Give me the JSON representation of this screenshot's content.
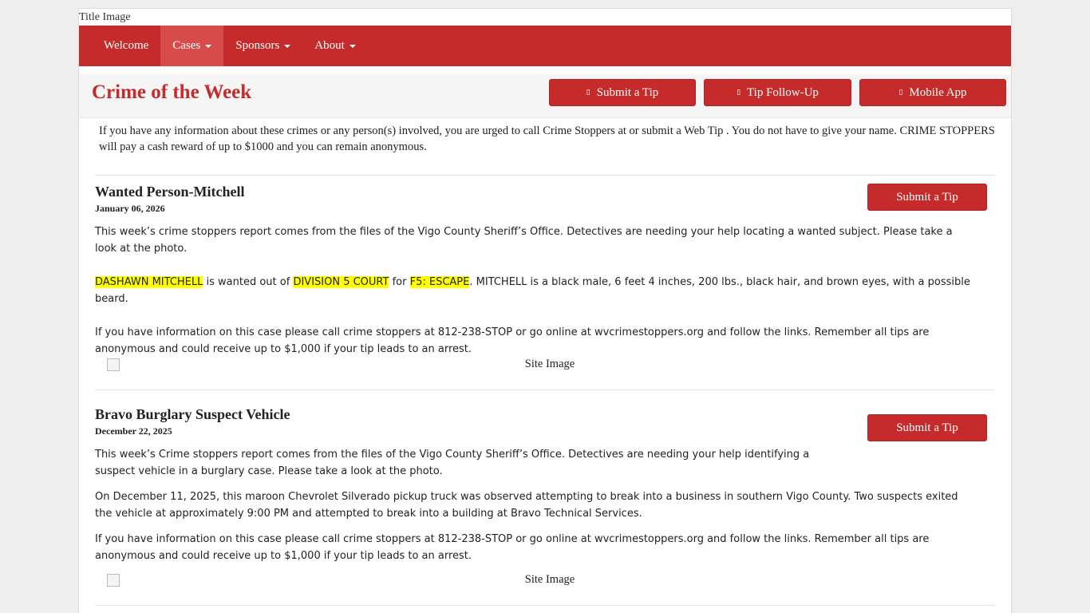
{
  "title_image_alt": "Title Image",
  "nav": {
    "items": [
      {
        "label": "Welcome",
        "caret": false
      },
      {
        "label": "Cases",
        "caret": true
      },
      {
        "label": "Sponsors",
        "caret": true
      },
      {
        "label": "About",
        "caret": true
      }
    ]
  },
  "header": {
    "title": "Crime of the Week",
    "buttons": {
      "submit_tip": "Submit a Tip",
      "tip_followup": "Tip Follow-Up",
      "mobile_app": "Mobile App"
    },
    "button_icon": "missing-glyph-icon"
  },
  "intro": "If you have any information about these crimes or any person(s) involved, you are urged to call Crime Stoppers at or submit a Web Tip .  You do not have to give your name.  CRIME STOPPERS will pay a cash reward of up to $1000 and you can remain anonymous.",
  "cases": [
    {
      "title": "Wanted Person-Mitchell",
      "date": "January 06, 2026",
      "button": "Submit a Tip",
      "para1": "This week’s crime stoppers report comes from the files of the Vigo County Sheriff’s Office.  Detectives are needing your help locating a wanted subject.  Please take a look at the photo.",
      "name": "DASHAWN MITCHELL",
      "text_a": " is wanted out of ",
      "court": "DIVISION 5 COURT",
      "text_b": " for ",
      "charge": "F5: ESCAPE",
      "text_c": ". MITCHELL is a black male, 6 feet 4 inches, 200 lbs., black hair, and brown eyes, with a possible beard.",
      "para3": "If you have information on this case please call crime stoppers at 812-238-STOP or go online at wvcrimestoppers.org and follow the links.  Remember all tips are anonymous and could receive up to $1,000 if your tip leads to an arrest.",
      "image_alt": "Site Image"
    },
    {
      "title": "Bravo Burglary Suspect Vehicle",
      "date": "December 22, 2025",
      "button": "Submit a Tip",
      "para1": "This week’s Crime stoppers report comes from the files of the Vigo County Sheriff’s Office.  Detectives are needing your help identifying a suspect vehicle in a burglary case.  Please take a look at the photo.",
      "para2": "On December 11, 2025, this maroon Chevrolet Silverado pickup truck was observed attempting to break into a business in southern Vigo County. Two suspects exited the vehicle at approximately 9:00 PM and attempted to break into a building at Bravo Technical Services.",
      "para3": "If you have information on this case please call crime stoppers at 812-238-STOP or go online at wvcrimestoppers.org and follow the links.  Remember all tips are anonymous and could receive up to $1,000 if your tip leads to an arrest.",
      "image_alt": "Site Image"
    }
  ],
  "colors": {
    "brand_red": "#c62b2b",
    "highlight": "#ffff00"
  }
}
